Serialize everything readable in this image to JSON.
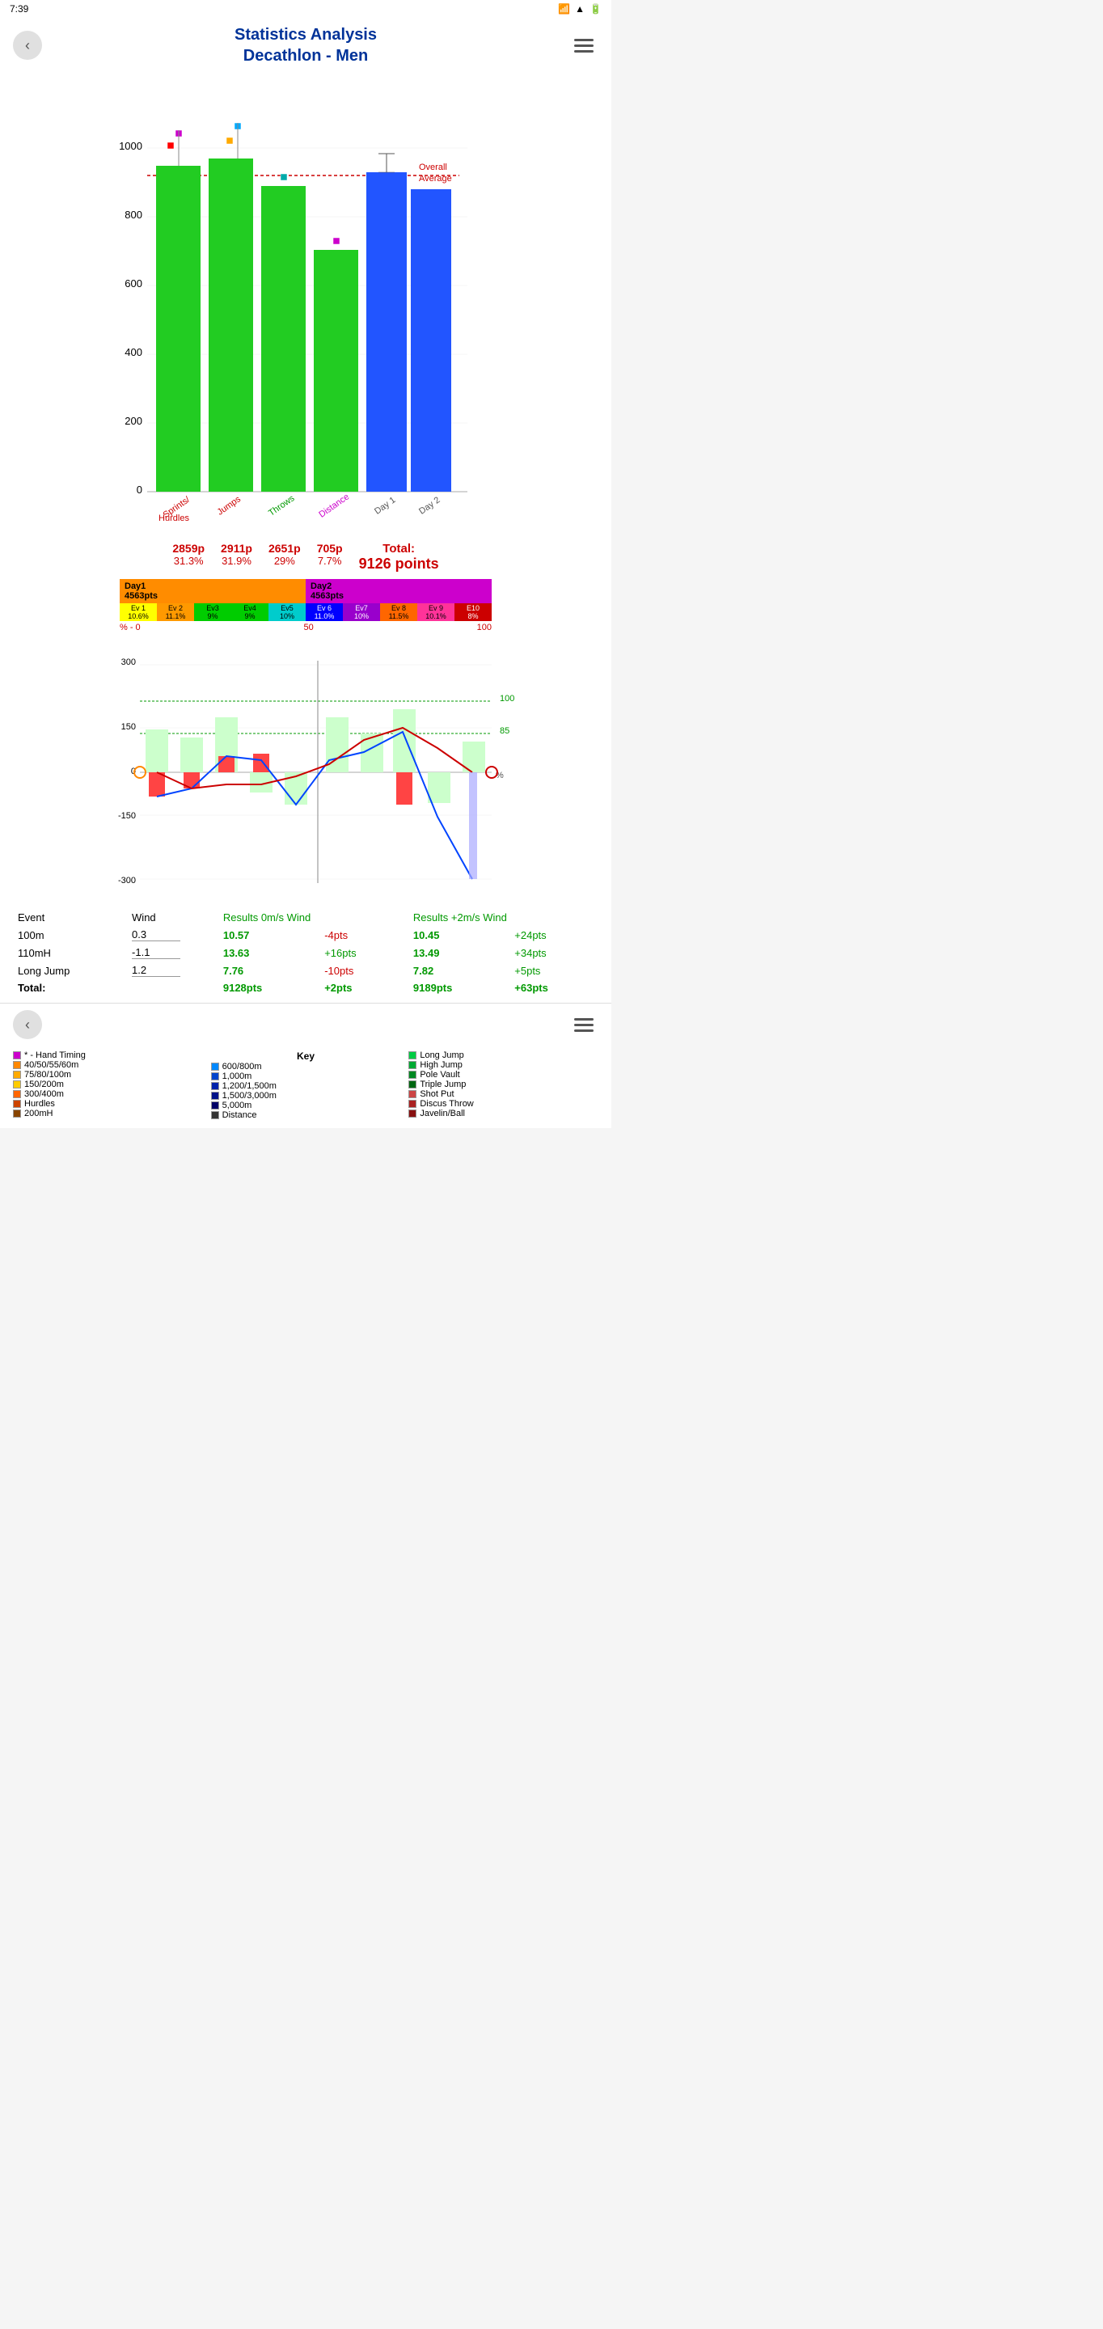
{
  "statusBar": {
    "time": "7:39"
  },
  "header": {
    "backLabel": "‹",
    "title1": "Statistics Analysis",
    "title2": "Decathlon - Men",
    "menuLabel": "menu"
  },
  "barChart": {
    "yLabels": [
      "0",
      "200",
      "400",
      "600",
      "800",
      "1000"
    ],
    "xLabels": [
      "Sprints/\nHurdles",
      "Jumps",
      "Throws",
      "Distance",
      "Day 1",
      "Day 2"
    ],
    "overallAverageLabel": "Overall\nAverage",
    "bars": [
      {
        "label": "Sprints/\nHurdles",
        "value": 950,
        "color": "#22cc22",
        "type": "green"
      },
      {
        "label": "Jumps",
        "value": 970,
        "color": "#22cc22",
        "type": "green"
      },
      {
        "label": "Throws",
        "value": 890,
        "color": "#22cc22",
        "type": "green"
      },
      {
        "label": "Distance",
        "value": 705,
        "color": "#22cc22",
        "type": "green"
      },
      {
        "label": "Day 1",
        "value": 930,
        "color": "#0044ff",
        "type": "blue"
      },
      {
        "label": "Day 2",
        "value": 880,
        "color": "#0044ff",
        "type": "blue"
      }
    ]
  },
  "stats": {
    "groups": [
      {
        "points": "2859p",
        "pct": "31.3%"
      },
      {
        "points": "2911p",
        "pct": "31.9%"
      },
      {
        "points": "2651p",
        "pct": "29%"
      },
      {
        "points": "705p",
        "pct": "7.7%"
      }
    ],
    "totalLabel": "Total:",
    "totalValue": "9126 points"
  },
  "dayBars": {
    "day1Label": "Day1",
    "day1Pts": "4563pts",
    "day2Label": "Day2",
    "day2Pts": "4563pts"
  },
  "events": [
    {
      "label": "Ev 1",
      "pct": "10.6%"
    },
    {
      "label": "Ev 2",
      "pct": "11.1%"
    },
    {
      "label": "Ev3",
      "pct": "9%"
    },
    {
      "label": "Ev4",
      "pct": "9%"
    },
    {
      "label": "Ev5",
      "pct": "10%"
    },
    {
      "label": "Ev 6",
      "pct": "11.0%"
    },
    {
      "label": "Ev7",
      "pct": "10%"
    },
    {
      "label": "Ev 8",
      "pct": "11.5%"
    },
    {
      "label": "Ev 9",
      "pct": "10.1%"
    },
    {
      "label": "E10",
      "pct": "8%"
    }
  ],
  "pctAxis": {
    "left": "% - 0",
    "mid": "50",
    "right": "100"
  },
  "lineChart": {
    "yLabels": [
      "-300",
      "-150",
      "0",
      "150",
      "300"
    ],
    "rightLabels": [
      "100",
      "85",
      "%"
    ],
    "note": "line chart of per-event deviation"
  },
  "table": {
    "headers": {
      "event": "Event",
      "wind": "Wind",
      "res0": "Results 0m/s Wind",
      "res2": "Results +2m/s Wind"
    },
    "rows": [
      {
        "event": "100m",
        "wind": "0.3",
        "result0": "10.57",
        "wind0": "-4pts",
        "result2": "10.45",
        "wind2": "+24pts"
      },
      {
        "event": "110mH",
        "wind": "-1.1",
        "result0": "13.63",
        "wind0": "+16pts",
        "result2": "13.49",
        "wind2": "+34pts"
      },
      {
        "event": "Long Jump",
        "wind": "1.2",
        "result0": "7.76",
        "wind0": "-10pts",
        "result2": "7.82",
        "wind2": "+5pts"
      },
      {
        "event": "Total:",
        "wind": "",
        "result0": "9128pts",
        "wind0": "+2pts",
        "result2": "9189pts",
        "wind2": "+63pts"
      }
    ]
  },
  "bottomNav": {
    "backLabel": "‹",
    "menuLabel": "menu"
  },
  "key": {
    "title": "Key",
    "items": [
      {
        "color": "#cc00cc",
        "label": "* - Hand Timing"
      },
      {
        "color": "#ff8800",
        "label": "40/50/55/60m"
      },
      {
        "color": "#ffaa00",
        "label": "75/80/100m"
      },
      {
        "color": "#ffcc00",
        "label": "150/200m"
      },
      {
        "color": "#ff6600",
        "label": "300/400m"
      },
      {
        "color": "#cc4400",
        "label": "Hurdles"
      },
      {
        "color": "#884400",
        "label": "200mH"
      },
      {
        "color": "#0088ff",
        "label": "600/800m"
      },
      {
        "color": "#0044cc",
        "label": "1,000m"
      },
      {
        "color": "#0022aa",
        "label": "1,200/1,500m"
      },
      {
        "color": "#001188",
        "label": "1,500/3,000m"
      },
      {
        "color": "#000066",
        "label": "5,000m"
      },
      {
        "color": "#000033",
        "label": "Distance"
      },
      {
        "color": "#00cc44",
        "label": "Long Jump"
      },
      {
        "color": "#00aa33",
        "label": "High Jump"
      },
      {
        "color": "#008822",
        "label": "Pole Vault"
      },
      {
        "color": "#006611",
        "label": "Triple Jump"
      },
      {
        "color": "#cc4444",
        "label": "Shot Put"
      },
      {
        "color": "#aa2222",
        "label": "Discus Throw"
      },
      {
        "color": "#881111",
        "label": "Javelin/Ball"
      }
    ]
  }
}
